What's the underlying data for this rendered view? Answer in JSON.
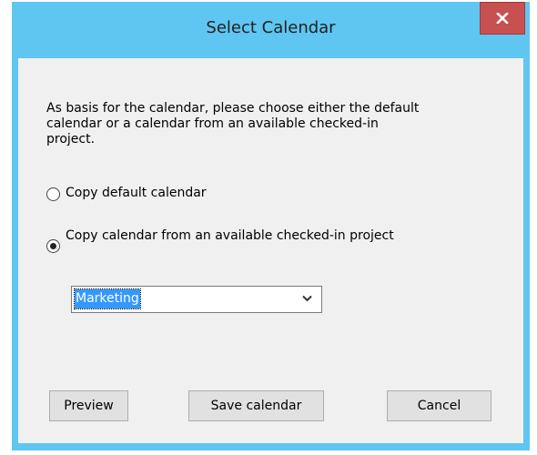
{
  "window": {
    "title": "Select Calendar",
    "close_icon": "close-icon"
  },
  "dialog": {
    "prompt": "As basis for the calendar, please choose either the default calendar or a calendar from an available checked-in project.",
    "option_default_label": "Copy default calendar",
    "option_default_checked": false,
    "option_project_label": "Copy calendar from an available checked-in project",
    "option_project_checked": true,
    "project_select_value": "Marketing",
    "buttons": {
      "preview": "Preview",
      "save": "Save calendar",
      "cancel": "Cancel"
    }
  },
  "colors": {
    "frame": "#5fc6f1",
    "close_button": "#c75050",
    "client_bg": "#f0f0f0",
    "selection": "#3399ff"
  }
}
